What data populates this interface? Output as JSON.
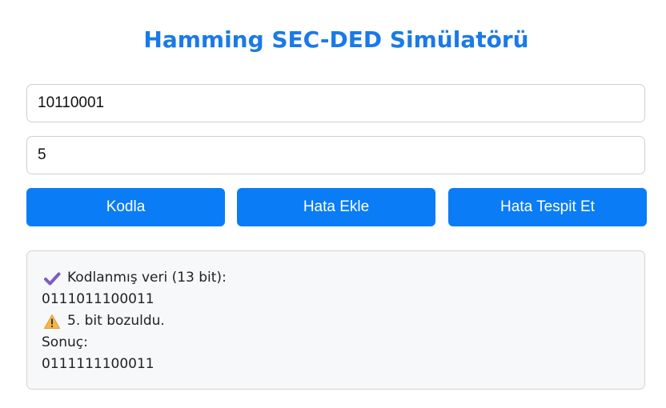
{
  "title": "Hamming SEC-DED Simülatörü",
  "inputs": {
    "data_value": "10110001",
    "bit_value": "5"
  },
  "buttons": {
    "encode": "Kodla",
    "inject": "Hata Ekle",
    "detect": "Hata Tespit Et"
  },
  "output": {
    "encoded_label": "Kodlanmış veri (13 bit):",
    "encoded_bits": "0111011100011",
    "error_msg": "5. bit bozuldu.",
    "result_label": "Sonuç:",
    "result_bits": "0111111100011",
    "icons": [
      "check-icon",
      "warning-icon"
    ]
  },
  "colors": {
    "title": "#1a7ae8",
    "button": "#0a7cf6",
    "check": "#7b5cc4",
    "warning": "#f2b64a"
  }
}
